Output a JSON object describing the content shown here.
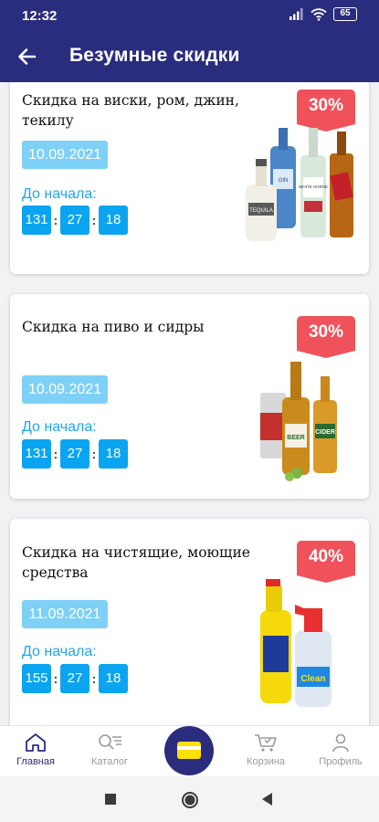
{
  "status_bar": {
    "time": "12:32",
    "battery": "65"
  },
  "header": {
    "title": "Безумные скидки"
  },
  "cards": [
    {
      "title": "Скидка на виски, ром, джин, текилу",
      "discount": "30%",
      "date": "10.09.2021",
      "start_label": "До начала:",
      "timer": [
        "131",
        "27",
        "18"
      ]
    },
    {
      "title": "Скидка на пиво и сидры",
      "discount": "30%",
      "date": "10.09.2021",
      "start_label": "До начала:",
      "timer": [
        "131",
        "27",
        "18"
      ]
    },
    {
      "title": "Скидка на чистящие, моющие средства",
      "discount": "40%",
      "date": "11.09.2021",
      "start_label": "До начала:",
      "timer": [
        "155",
        "27",
        "18"
      ]
    }
  ],
  "product_labels": {
    "tequila": "TEQUILA",
    "gin": "GIN",
    "whisky": "WHITE HORSE",
    "beer": "BEER",
    "cider": "CIDER",
    "clean": "Clean"
  },
  "bottom_nav": [
    {
      "label": "Главная",
      "icon": "home-icon",
      "active": true
    },
    {
      "label": "Каталог",
      "icon": "catalog-search-icon",
      "active": false
    },
    {
      "label": "Корзина",
      "icon": "cart-icon",
      "active": false
    },
    {
      "label": "Профиль",
      "icon": "profile-icon",
      "active": false
    }
  ],
  "colors": {
    "primary": "#2a2c7e",
    "badge": "#f0525b",
    "date": "#7fd0f7",
    "timer": "#0aa4f0",
    "card_icon": "#fde100"
  }
}
